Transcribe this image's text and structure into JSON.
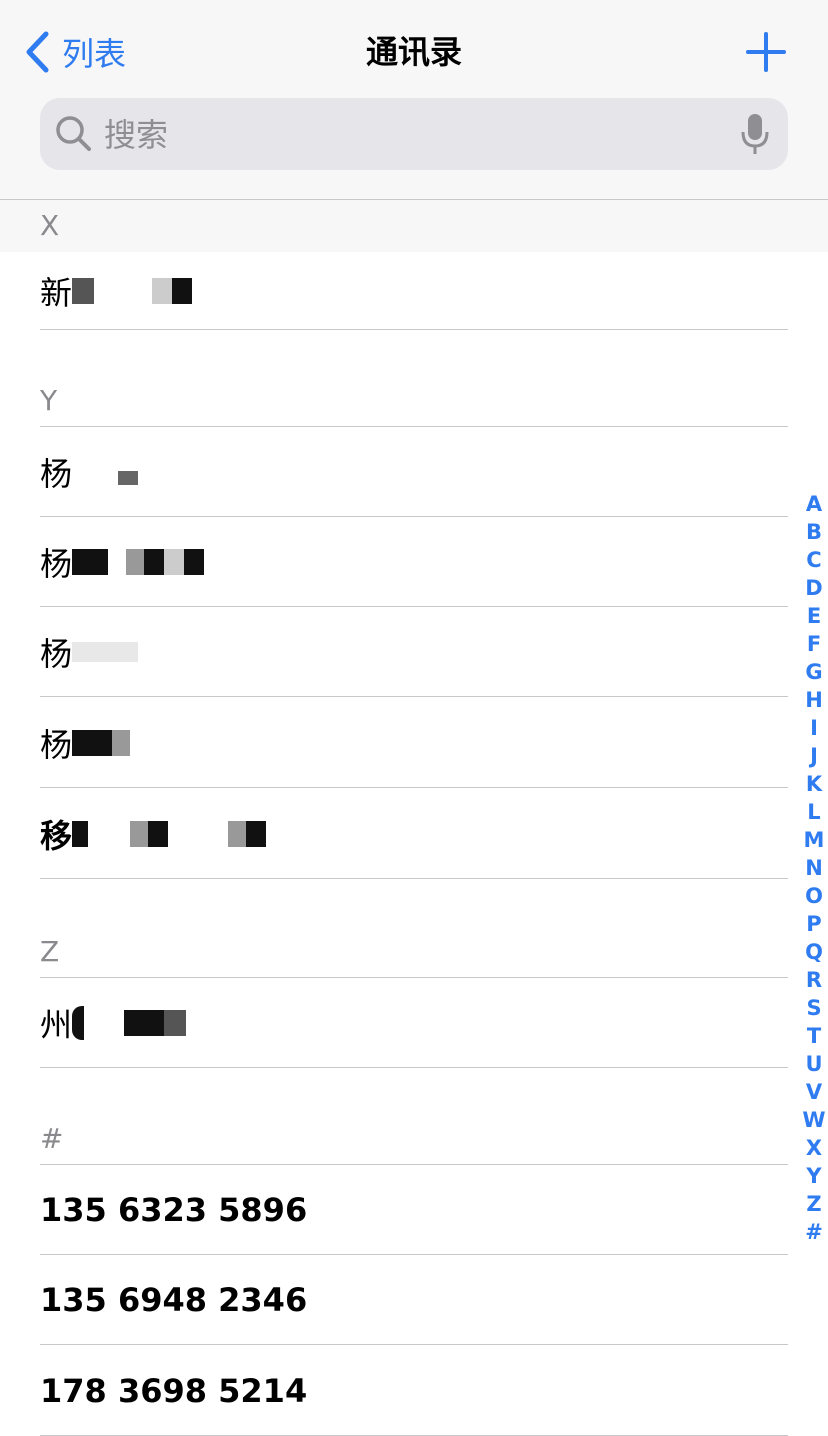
{
  "nav": {
    "back_label": "列表",
    "title": "通讯录"
  },
  "search": {
    "placeholder": "搜索"
  },
  "sections": {
    "x": "X",
    "y": "Y",
    "z": "Z",
    "hash": "#"
  },
  "contacts": {
    "x": [
      "新"
    ],
    "y": [
      "杨",
      "杨",
      "杨",
      "杨",
      "移"
    ],
    "z": [
      "州"
    ],
    "hash": [
      "135 6323 5896",
      "135 6948 2346",
      "178 3698 5214"
    ]
  },
  "index_letters": [
    "A",
    "B",
    "C",
    "D",
    "E",
    "F",
    "G",
    "H",
    "I",
    "J",
    "K",
    "L",
    "M",
    "N",
    "O",
    "P",
    "Q",
    "R",
    "S",
    "T",
    "U",
    "V",
    "W",
    "X",
    "Y",
    "Z",
    "#"
  ],
  "colors": {
    "accent": "#2f7bf0",
    "header_bg": "#f7f7f8",
    "separator": "#c8c8cc",
    "section_text": "#8a8a8e"
  }
}
